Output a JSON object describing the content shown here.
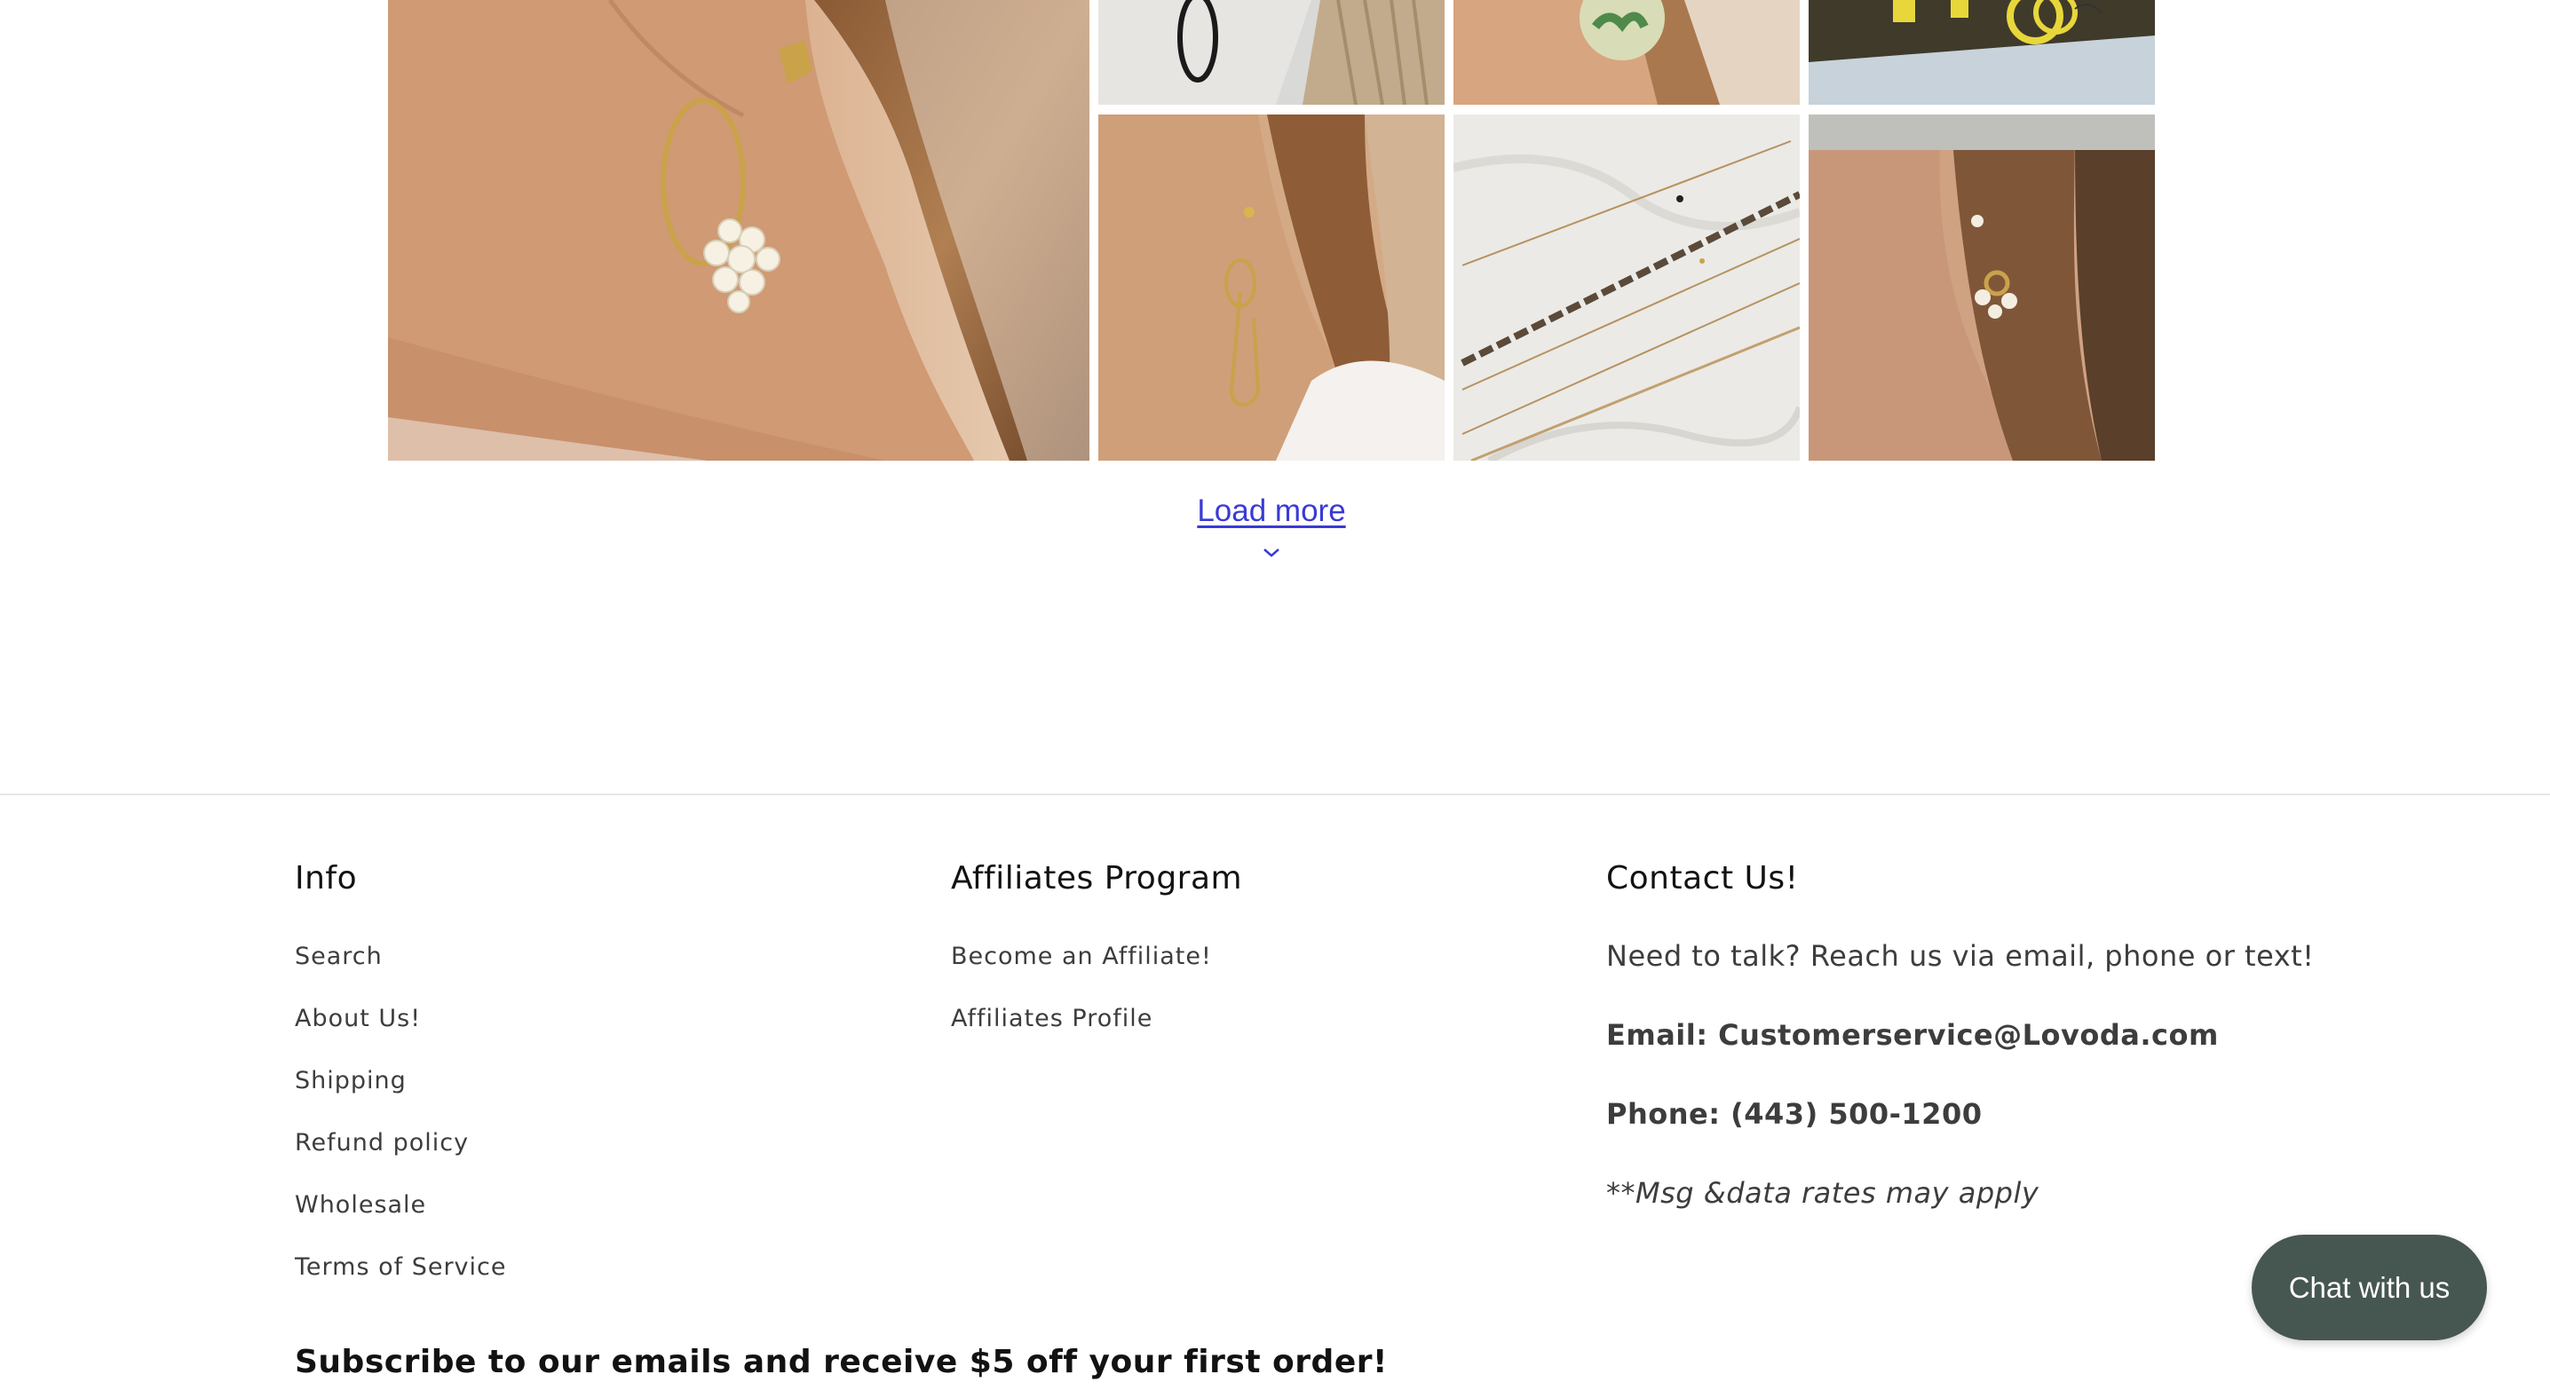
{
  "gallery": {
    "photos": [
      {
        "subject": "ear with gold hoop and pearl cluster earring"
      },
      {
        "subject": "gold oval link on marble"
      },
      {
        "subject": "ear with monstera leaf earring"
      },
      {
        "subject": "yellow hoops on display"
      },
      {
        "subject": "ear with gold threader earring"
      },
      {
        "subject": "gold chain bracelets on marble"
      },
      {
        "subject": "ear with pearl huggie hoops"
      }
    ],
    "load_more_label": "Load more"
  },
  "footer": {
    "info": {
      "heading": "Info",
      "links": [
        "Search",
        "About Us!",
        "Shipping",
        "Refund policy",
        "Wholesale",
        "Terms of Service"
      ]
    },
    "affiliates": {
      "heading": "Affiliates Program",
      "links": [
        "Become an Affiliate!",
        "Affiliates Profile"
      ]
    },
    "contact": {
      "heading": "Contact Us!",
      "intro": "Need to talk? Reach us via email, phone or text!",
      "email": "Email: Customerservice@Lovoda.com",
      "phone": "Phone: (443) 500-1200",
      "note": "**Msg &data rates may apply"
    },
    "subscribe_heading": "Subscribe to our emails and receive $5 off your first order!"
  },
  "chat": {
    "label": "Chat with us",
    "color": "#465651"
  },
  "colors": {
    "link_accent": "#3a3ad6",
    "text": "#121212",
    "muted_text": "#3d3d3d"
  }
}
